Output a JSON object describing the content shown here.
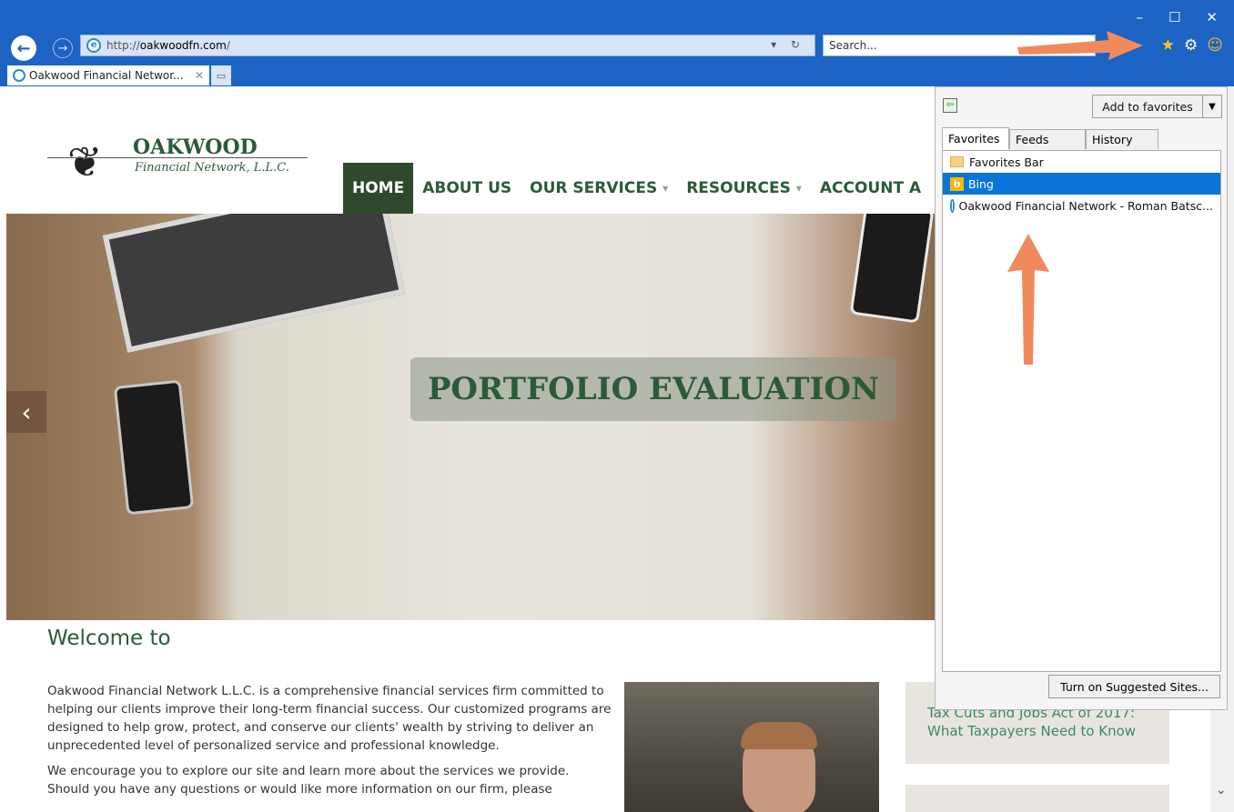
{
  "browser": {
    "address": {
      "protocol": "http://",
      "host": "oakwoodfn.com",
      "path": "/"
    },
    "address_tools": "▾ ↻",
    "search_placeholder": "Search...",
    "tab_title": "Oakwood Financial Networ...",
    "tab_close": "✕",
    "back": "←",
    "forward": "→",
    "win_minimize": "–",
    "win_maximize": "☐",
    "win_close": "✕",
    "tools": {
      "favorites": "★",
      "settings": "⚙",
      "feedback": "☺"
    }
  },
  "site": {
    "logo_name": "OAKWOOD",
    "logo_sub": "Financial Network, L.L.C.",
    "nav": [
      {
        "label": "HOME",
        "active": true
      },
      {
        "label": "ABOUT US"
      },
      {
        "label": "OUR SERVICES",
        "caret": "▾"
      },
      {
        "label": "RESOURCES",
        "caret": "▾"
      },
      {
        "label": "ACCOUNT A"
      }
    ],
    "hero_title": "PORTFOLIO EVALUATION",
    "hero_prev": "‹",
    "welcome": "Welcome to",
    "intro_p1": "Oakwood Financial Network L.L.C. is a comprehensive financial services firm committed to helping our clients improve their long-term financial success. Our customized programs are designed to help grow, protect, and conserve our clients' wealth by striving to deliver an unprecedented level of personalized service and professional knowledge.",
    "intro_p2": "We encourage you to explore our site and learn more about the services we provide. Should you have any questions or would like more information on our firm, please",
    "card1_line1": "Tax Cuts and Jobs Act of 2017:",
    "card1_line2": "What Taxpayers Need to Know"
  },
  "favorites_pane": {
    "add_button": "Add to favorites",
    "add_drop": "▼",
    "tabs": [
      "Favorites",
      "Feeds",
      "History"
    ],
    "items": [
      {
        "label": "Favorites Bar",
        "icon": "folder-icon"
      },
      {
        "label": "Bing",
        "icon": "bing-icon",
        "selected": true
      },
      {
        "label": "Oakwood Financial Network - Roman Batsc...",
        "icon": "ie-icon"
      }
    ],
    "suggested_button": "Turn on Suggested Sites..."
  },
  "colors": {
    "chrome_blue": "#1d63c4",
    "brand_green": "#2b5a3a",
    "nav_active": "#2e4a2c",
    "selected_blue": "#0a74d8",
    "arrow": "#f08a5d"
  }
}
